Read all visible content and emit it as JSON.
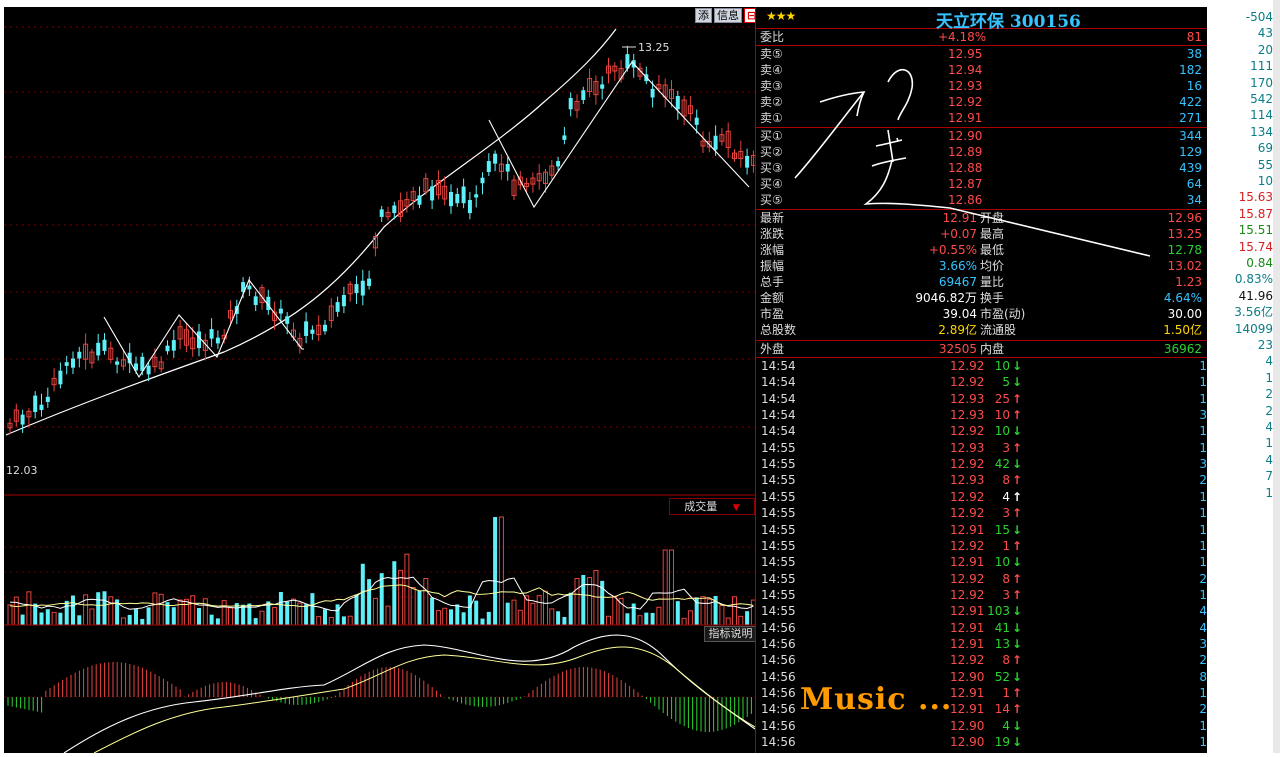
{
  "header": {
    "buttons": [
      "添",
      "信息",
      "⊟"
    ]
  },
  "main_chart": {
    "high_label": "13.25",
    "low_label": "12.03",
    "volume_indicator": "成交量",
    "volume_arrow": "▼",
    "indicator_help": "指标说明",
    "colors": {
      "up": "#e8433e",
      "down": "#5ef0f8",
      "ma": "#ffffff",
      "ma2": "#ffff99"
    }
  },
  "quote_panel": {
    "stars": "★★★",
    "name": "天立环保 300156",
    "weibi": {
      "label": "委比",
      "value": "+4.18%",
      "diff": "81"
    },
    "asks": [
      {
        "label": "卖⑤",
        "price": "12.95",
        "volume": "38"
      },
      {
        "label": "卖④",
        "price": "12.94",
        "volume": "182"
      },
      {
        "label": "卖③",
        "price": "12.93",
        "volume": "16"
      },
      {
        "label": "卖②",
        "price": "12.92",
        "volume": "422"
      },
      {
        "label": "卖①",
        "price": "12.91",
        "volume": "271"
      }
    ],
    "bids": [
      {
        "label": "买①",
        "price": "12.90",
        "volume": "344"
      },
      {
        "label": "买②",
        "price": "12.89",
        "volume": "129"
      },
      {
        "label": "买③",
        "price": "12.88",
        "volume": "439"
      },
      {
        "label": "买④",
        "price": "12.87",
        "volume": "64"
      },
      {
        "label": "买⑤",
        "price": "12.86",
        "volume": "34"
      }
    ],
    "stats": [
      {
        "l1": "最新",
        "v1": "12.91",
        "l2": "开盘",
        "v2": "12.96",
        "c1": "cred",
        "c2": "cred"
      },
      {
        "l1": "涨跌",
        "v1": "+0.07",
        "l2": "最高",
        "v2": "13.25",
        "c1": "cred",
        "c2": "cred"
      },
      {
        "l1": "涨幅",
        "v1": "+0.55%",
        "l2": "最低",
        "v2": "12.78",
        "c1": "cred",
        "c2": "cgreen"
      },
      {
        "l1": "振幅",
        "v1": "3.66%",
        "l2": "均价",
        "v2": "13.02",
        "c1": "ccyan",
        "c2": "cred"
      },
      {
        "l1": "总手",
        "v1": "69467",
        "l2": "量比",
        "v2": "1.23",
        "c1": "ccyan",
        "c2": "cred"
      },
      {
        "l1": "金额",
        "v1": "9046.82万",
        "l2": "换手",
        "v2": "4.64%",
        "c1": "cwhite",
        "c2": "ccyan"
      },
      {
        "l1": "市盈",
        "v1": "39.04",
        "l2": "市盈(动)",
        "v2": "30.00",
        "c1": "cwhite",
        "c2": "cwhite"
      },
      {
        "l1": "总股数",
        "v1": "2.89亿",
        "l2": "流通股",
        "v2": "1.50亿",
        "c1": "cyellow",
        "c2": "cyellow"
      }
    ],
    "outer": {
      "label": "外盘",
      "value": "32505",
      "label2": "内盘",
      "value2": "36962"
    },
    "ticks": [
      {
        "time": "14:54",
        "price": "12.92",
        "vol": "10",
        "dir": "down",
        "n": "1"
      },
      {
        "time": "14:54",
        "price": "12.92",
        "vol": "5",
        "dir": "down",
        "n": "1"
      },
      {
        "time": "14:54",
        "price": "12.93",
        "vol": "25",
        "dir": "up",
        "n": "1"
      },
      {
        "time": "14:54",
        "price": "12.93",
        "vol": "10",
        "dir": "up",
        "n": "3"
      },
      {
        "time": "14:54",
        "price": "12.92",
        "vol": "10",
        "dir": "down",
        "n": "1"
      },
      {
        "time": "14:55",
        "price": "12.93",
        "vol": "3",
        "dir": "up",
        "n": "1"
      },
      {
        "time": "14:55",
        "price": "12.92",
        "vol": "42",
        "dir": "down",
        "n": "3"
      },
      {
        "time": "14:55",
        "price": "12.93",
        "vol": "8",
        "dir": "up",
        "n": "2"
      },
      {
        "time": "14:55",
        "price": "12.92",
        "vol": "4",
        "dir": "neutral",
        "n": "1"
      },
      {
        "time": "14:55",
        "price": "12.92",
        "vol": "3",
        "dir": "up",
        "n": "1"
      },
      {
        "time": "14:55",
        "price": "12.91",
        "vol": "15",
        "dir": "down",
        "n": "1"
      },
      {
        "time": "14:55",
        "price": "12.92",
        "vol": "1",
        "dir": "up",
        "n": "1"
      },
      {
        "time": "14:55",
        "price": "12.91",
        "vol": "10",
        "dir": "down",
        "n": "1"
      },
      {
        "time": "14:55",
        "price": "12.92",
        "vol": "8",
        "dir": "up",
        "n": "2"
      },
      {
        "time": "14:55",
        "price": "12.92",
        "vol": "3",
        "dir": "up",
        "n": "1"
      },
      {
        "time": "14:55",
        "price": "12.91",
        "vol": "103",
        "dir": "down",
        "n": "4"
      },
      {
        "time": "14:56",
        "price": "12.91",
        "vol": "41",
        "dir": "down",
        "n": "4"
      },
      {
        "time": "14:56",
        "price": "12.91",
        "vol": "13",
        "dir": "down",
        "n": "3"
      },
      {
        "time": "14:56",
        "price": "12.92",
        "vol": "8",
        "dir": "up",
        "n": "2"
      },
      {
        "time": "14:56",
        "price": "12.90",
        "vol": "52",
        "dir": "down",
        "n": "8"
      },
      {
        "time": "14:56",
        "price": "12.91",
        "vol": "1",
        "dir": "up",
        "n": "1"
      },
      {
        "time": "14:56",
        "price": "12.91",
        "vol": "14",
        "dir": "up",
        "n": "2"
      },
      {
        "time": "14:56",
        "price": "12.90",
        "vol": "4",
        "dir": "down",
        "n": "1"
      },
      {
        "time": "14:56",
        "price": "12.90",
        "vol": "19",
        "dir": "down",
        "n": "1"
      }
    ]
  },
  "side_list": [
    {
      "v": "-504",
      "c": "#0a7d86"
    },
    {
      "v": "43",
      "c": "#0a7d86"
    },
    {
      "v": "20",
      "c": "#0a7d86"
    },
    {
      "v": "111",
      "c": "#0a7d86"
    },
    {
      "v": "170",
      "c": "#0a7d86"
    },
    {
      "v": "542",
      "c": "#0a7d86"
    },
    {
      "v": "114",
      "c": "#0a7d86"
    },
    {
      "v": "134",
      "c": "#0a7d86"
    },
    {
      "v": "69",
      "c": "#0a7d86"
    },
    {
      "v": "55",
      "c": "#0a7d86"
    },
    {
      "v": "10",
      "c": "#0a7d86"
    },
    {
      "v": "15.63",
      "c": "#d62020"
    },
    {
      "v": "15.87",
      "c": "#d62020"
    },
    {
      "v": "15.51",
      "c": "#178a17"
    },
    {
      "v": "15.74",
      "c": "#d62020"
    },
    {
      "v": "0.84",
      "c": "#178a17"
    },
    {
      "v": "0.83%",
      "c": "#0a7d86"
    },
    {
      "v": "41.96",
      "c": "#111111"
    },
    {
      "v": "3.56亿",
      "c": "#0a7d86"
    },
    {
      "v": "14099",
      "c": "#0a7d86"
    },
    {
      "v": "23",
      "c": "#0a7d86"
    },
    {
      "v": "4",
      "c": "#0a7d86"
    },
    {
      "v": "1",
      "c": "#0a7d86"
    },
    {
      "v": "2",
      "c": "#0a7d86"
    },
    {
      "v": "2",
      "c": "#0a7d86"
    },
    {
      "v": "4",
      "c": "#0a7d86"
    },
    {
      "v": "1",
      "c": "#0a7d86"
    },
    {
      "v": "4",
      "c": "#0a7d86"
    },
    {
      "v": "7",
      "c": "#0a7d86"
    },
    {
      "v": "1",
      "c": "#0a7d86"
    }
  ],
  "overlay": {
    "music_text": "Music ..."
  }
}
